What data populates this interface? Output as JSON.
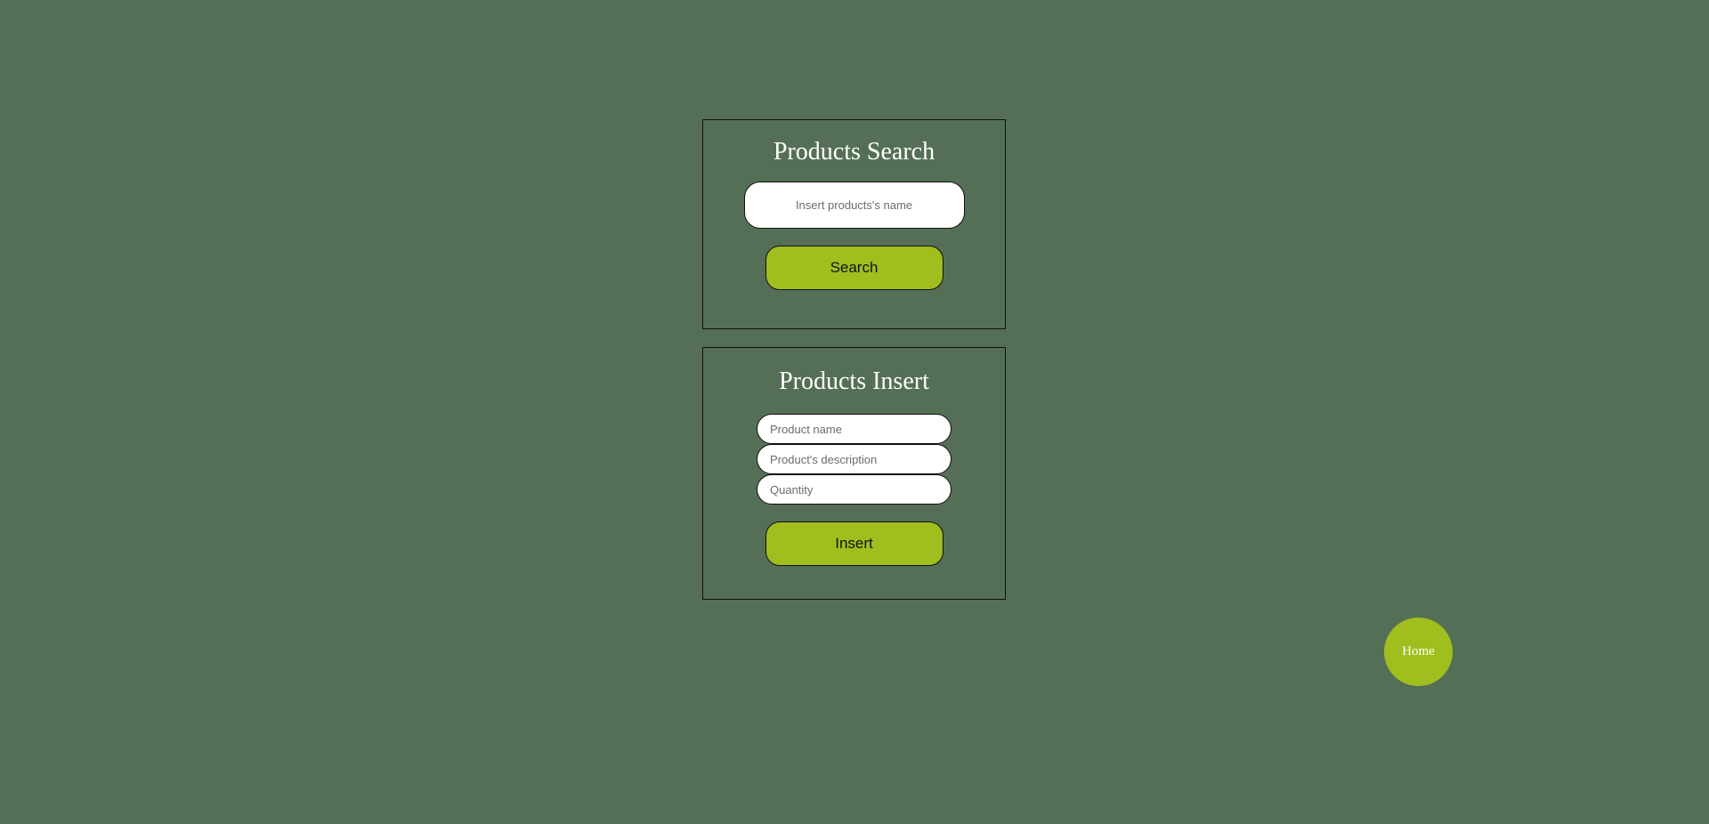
{
  "search_panel": {
    "title": "Products Search",
    "input_placeholder": "Insert products's name",
    "input_value": "",
    "button_label": "Search"
  },
  "insert_panel": {
    "title": "Products Insert",
    "name_placeholder": "Product name",
    "description_placeholder": "Product's description",
    "quantity_placeholder": "Quantity",
    "button_label": "Insert"
  },
  "home_button": {
    "label": "Home"
  },
  "colors": {
    "background": "#546f55",
    "accent": "#a0be1e",
    "title_text": "#ffffff",
    "border": "#111111"
  }
}
